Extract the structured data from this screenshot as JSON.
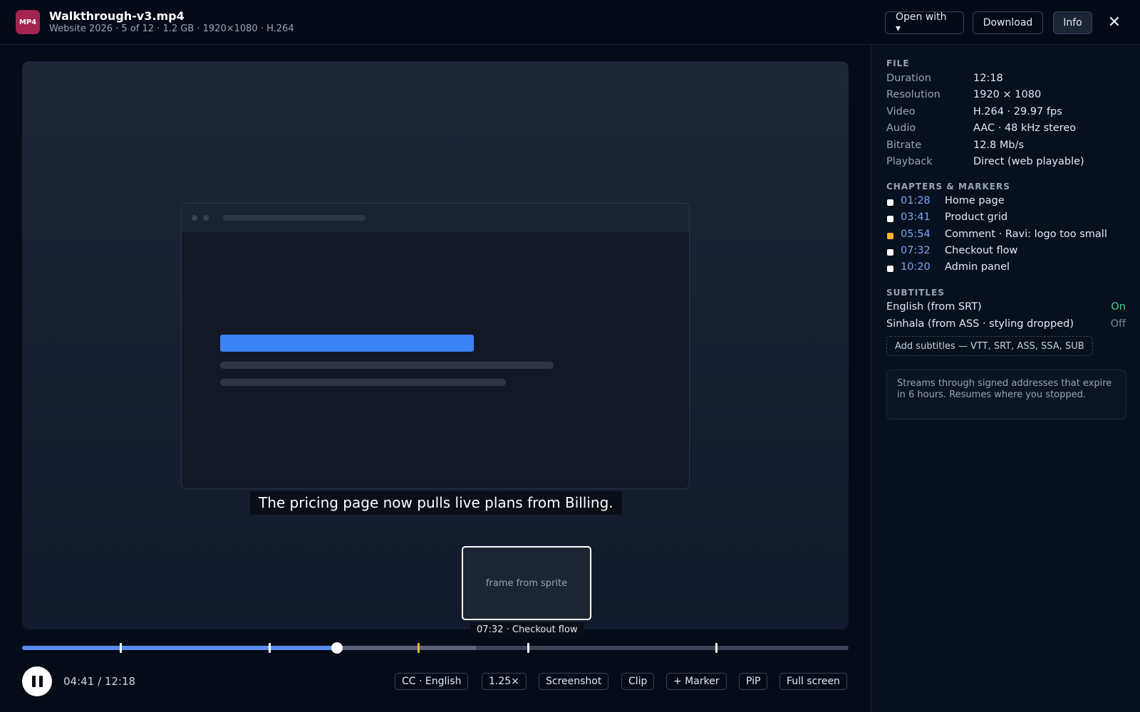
{
  "header": {
    "badge": "MP4",
    "file_name": "Walkthrough-v3.mp4",
    "file_meta": "Website 2026 · 5 of 12 · 1.2 GB · 1920×1080 · H.264",
    "open_with_label": "Open with ▾",
    "download_label": "Download",
    "info_label": "Info",
    "close_glyph": "✕"
  },
  "player": {
    "subtitle_text": "The pricing page now pulls live plans from Billing.",
    "hover_preview_text": "frame from sprite",
    "hover_preview_caption": "07:32 · Checkout flow",
    "current_time": "04:41",
    "duration": "12:18",
    "time_readout": "04:41 / 12:18",
    "played_fraction": 0.381,
    "buffered_fraction": 0.55,
    "hover_fraction": 0.611
  },
  "timeline_markers": [
    {
      "time": "01:28",
      "seconds": 88,
      "kind": "chapter"
    },
    {
      "time": "03:41",
      "seconds": 221,
      "kind": "chapter"
    },
    {
      "time": "05:54",
      "seconds": 354,
      "kind": "comment"
    },
    {
      "time": "07:32",
      "seconds": 452,
      "kind": "chapter"
    },
    {
      "time": "10:20",
      "seconds": 620,
      "kind": "chapter"
    }
  ],
  "controls": {
    "cc_label": "CC · English",
    "speed_label": "1.25×",
    "screenshot_label": "Screenshot",
    "clip_label": "Clip",
    "marker_label": "+ Marker",
    "pip_label": "PiP",
    "fullscreen_label": "Full screen"
  },
  "info_panel": {
    "file_section": "FILE",
    "properties": [
      {
        "key": "Duration",
        "value": "12:18"
      },
      {
        "key": "Resolution",
        "value": "1920 × 1080"
      },
      {
        "key": "Video",
        "value": "H.264 · 29.97 fps"
      },
      {
        "key": "Audio",
        "value": "AAC · 48 kHz stereo"
      },
      {
        "key": "Bitrate",
        "value": "12.8 Mb/s"
      },
      {
        "key": "Playback",
        "value": "Direct (web playable)"
      }
    ],
    "chapters_section": "CHAPTERS & MARKERS",
    "chapters": [
      {
        "time": "01:28",
        "label": "Home page",
        "kind": "chapter"
      },
      {
        "time": "03:41",
        "label": "Product grid",
        "kind": "chapter"
      },
      {
        "time": "05:54",
        "label": "Comment · Ravi: logo too small",
        "kind": "comment"
      },
      {
        "time": "07:32",
        "label": "Checkout flow",
        "kind": "chapter"
      },
      {
        "time": "10:20",
        "label": "Admin panel",
        "kind": "chapter"
      }
    ],
    "subtitles_section": "SUBTITLES",
    "subtitles": [
      {
        "name": "English (from SRT)",
        "state": "On"
      },
      {
        "name": "Sinhala (from ASS · styling dropped)",
        "state": "Off"
      }
    ],
    "add_subtitles_label": "Add subtitles — VTT, SRT, ASS, SSA, SUB",
    "note": "Streams through signed addresses that expire in 6 hours. Resumes where you stopped."
  },
  "colors": {
    "accent": "#5b8def",
    "chapter_marker": "#ffffff",
    "comment_marker": "#f2b632",
    "subtitle_on": "#4fd18b",
    "badge": "#a3244f"
  }
}
